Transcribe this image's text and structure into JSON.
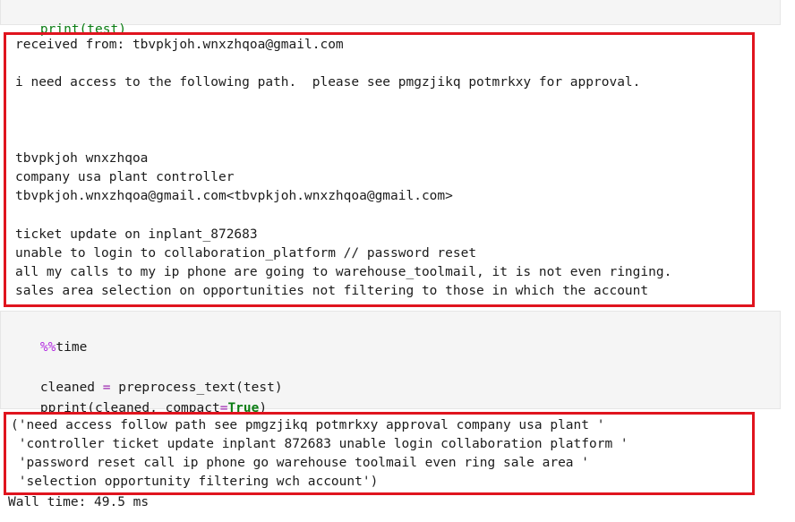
{
  "cell1": {
    "code": "print(test)"
  },
  "output1": {
    "lines": [
      "received from: tbvpkjoh.wnxzhqoa@gmail.com",
      "",
      "i need access to the following path.  please see pmgzjikq potmrkxy for approval.",
      "",
      "",
      "",
      "tbvpkjoh wnxzhqoa",
      "company usa plant controller",
      "tbvpkjoh.wnxzhqoa@gmail.com<tbvpkjoh.wnxzhqoa@gmail.com>",
      "",
      "ticket update on inplant_872683",
      "unable to login to collaboration_platform // password reset",
      "all my calls to my ip phone are going to warehouse_toolmail, it is not even ringing.",
      "sales area selection on opportunities not filtering to those in which the account"
    ]
  },
  "cell2": {
    "magic_prefix": "%%",
    "magic_name": "time",
    "line2_var": "cleaned",
    "line2_op": " = ",
    "line2_call": "preprocess_text(test)",
    "line3_fn": "pprint(cleaned, compact",
    "line3_eq": "=",
    "line3_kw": "True",
    "line3_end": ")"
  },
  "output2": {
    "lines": [
      "('need access follow path see pmgzjikq potmrkxy approval company usa plant '",
      " 'controller ticket update inplant 872683 unable login collaboration platform '",
      " 'password reset call ip phone go warehouse toolmail even ring sale area '",
      " 'selection opportunity filtering wch account')"
    ],
    "wall_time": "Wall time: 49.5 ms"
  },
  "colors": {
    "highlight_border": "#e0141e",
    "cell_bg": "#f5f5f5",
    "keyword_green": "#0a7d13",
    "magic_purple": "#b32de0"
  }
}
